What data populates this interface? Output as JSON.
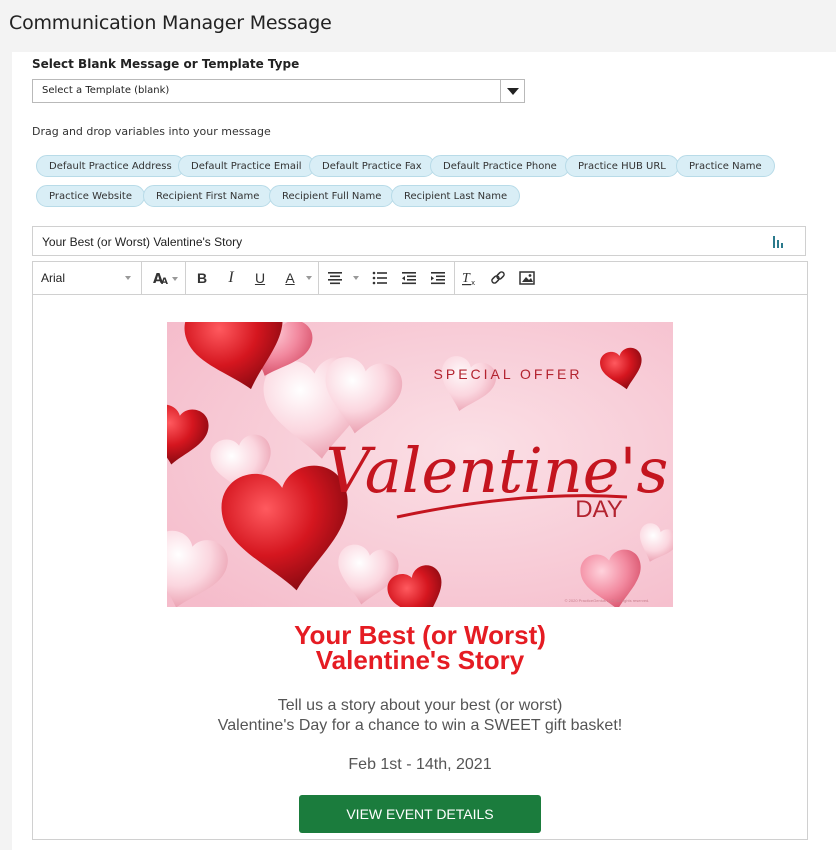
{
  "page": {
    "title": "Communication Manager Message"
  },
  "template_select": {
    "label": "Select Blank Message or Template Type",
    "value": "Select a Template (blank)"
  },
  "variables": {
    "label": "Drag and drop variables into your message",
    "chips": [
      "Default Practice Address",
      "Default Practice Email",
      "Default Practice Fax",
      "Default Practice Phone",
      "Practice HUB URL",
      "Practice Name",
      "Practice Website",
      "Recipient First Name",
      "Recipient Full Name",
      "Recipient Last Name"
    ]
  },
  "subject": {
    "value": "Your Best (or Worst) Valentine's Story"
  },
  "toolbar": {
    "font": "Arial",
    "bold": "B",
    "italic": "I",
    "underline": "U",
    "text_color": "A"
  },
  "message": {
    "banner": {
      "special_offer": "SPECIAL OFFER",
      "valentines": "Valentine's",
      "day": "DAY",
      "copyright": "© 2020 PracticeGenius LLC. All rights reserved."
    },
    "headline_line1": "Your Best (or Worst)",
    "headline_line2": "Valentine's Story",
    "body_line1": "Tell us a story about your best (or worst)",
    "body_line2": "Valentine's Day for a chance to win a SWEET gift basket!",
    "dates": "Feb 1st - 14th, 2021",
    "cta": "VIEW EVENT DETAILS"
  },
  "colors": {
    "headline": "#e51c23",
    "cta": "#1b7c3d",
    "chip": "#d9eef6",
    "banner_bg": "#f7c9d4"
  }
}
